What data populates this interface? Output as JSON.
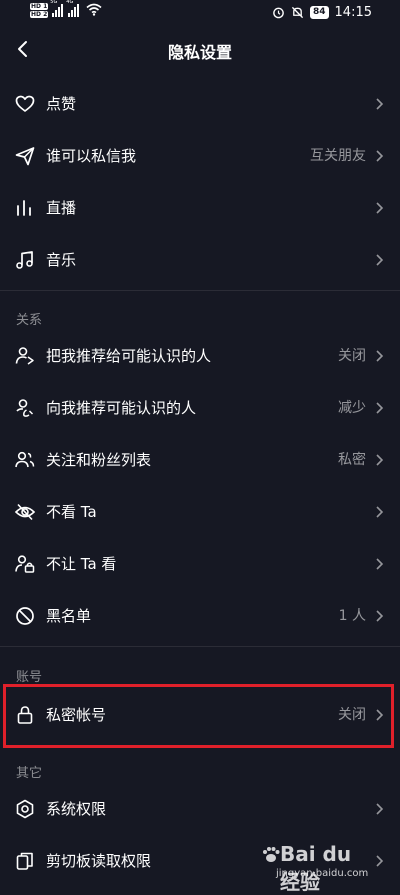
{
  "status_bar": {
    "sim1": "HD 1",
    "sim2": "HD 2",
    "net1": "5G",
    "net2": "4G",
    "battery": "84",
    "time": "14:15"
  },
  "header": {
    "title": "隐私设置",
    "back_icon": "chevron-left-icon"
  },
  "rows_top": [
    {
      "label": "点赞",
      "value": "",
      "icon": "heart-icon"
    },
    {
      "label": "谁可以私信我",
      "value": "互关朋友",
      "icon": "send-icon"
    },
    {
      "label": "直播",
      "value": "",
      "icon": "live-bars-icon"
    },
    {
      "label": "音乐",
      "value": "",
      "icon": "music-note-icon"
    }
  ],
  "section_relations": {
    "title": "关系",
    "rows": [
      {
        "label": "把我推荐给可能认识的人",
        "value": "关闭",
        "icon": "user-share-icon"
      },
      {
        "label": "向我推荐可能认识的人",
        "value": "减少",
        "icon": "user-recommend-icon"
      },
      {
        "label": "关注和粉丝列表",
        "value": "私密",
        "icon": "users-icon"
      },
      {
        "label": "不看 Ta",
        "value": "",
        "icon": "eye-off-icon"
      },
      {
        "label": "不让 Ta 看",
        "value": "",
        "icon": "user-lock-icon"
      },
      {
        "label": "黑名单",
        "value": "1 人",
        "icon": "block-icon"
      }
    ]
  },
  "section_account": {
    "title": "账号",
    "rows": [
      {
        "label": "私密帐号",
        "value": "关闭",
        "icon": "lock-icon"
      }
    ]
  },
  "section_other": {
    "title": "其它",
    "rows": [
      {
        "label": "系统权限",
        "value": "",
        "icon": "hexagon-settings-icon"
      },
      {
        "label": "剪切板读取权限",
        "value": "",
        "icon": "clipboard-icon"
      }
    ]
  },
  "watermark": {
    "brand": "Bai du 经验",
    "url": "jingyan.baidu.com"
  },
  "colors": {
    "background": "#161823",
    "highlight": "#e0202a"
  }
}
